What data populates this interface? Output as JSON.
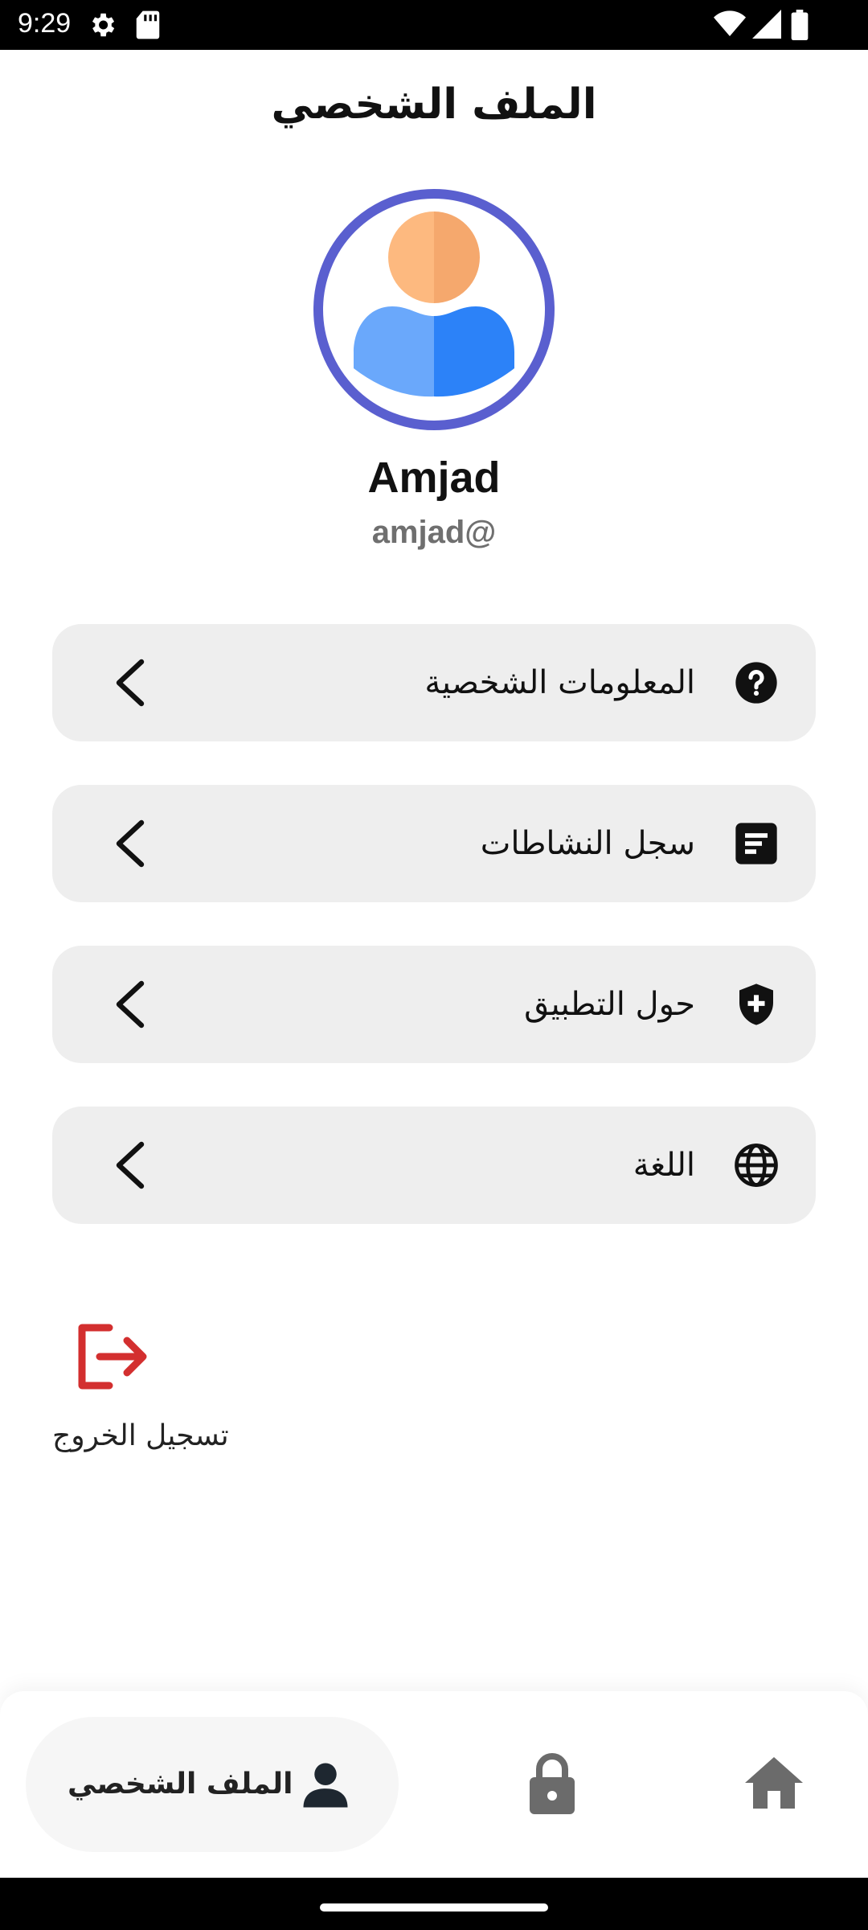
{
  "status_bar": {
    "time": "9:29"
  },
  "header": {
    "title": "الملف الشخصي"
  },
  "profile": {
    "name": "Amjad",
    "handle": "amjad@"
  },
  "menu": [
    {
      "label": "المعلومات الشخصية",
      "icon": "help-circle-icon"
    },
    {
      "label": "سجل النشاطات",
      "icon": "activity-log-icon"
    },
    {
      "label": "حول التطبيق",
      "icon": "shield-plus-icon"
    },
    {
      "label": "اللغة",
      "icon": "globe-icon"
    }
  ],
  "logout": {
    "label": "تسجيل الخروج",
    "color": "#d32f2f"
  },
  "bottom_nav": {
    "active_label": "الملف الشخصي",
    "items": [
      "profile-icon",
      "lock-icon",
      "home-icon"
    ]
  },
  "colors": {
    "avatar_ring": "#5a5fcf",
    "card_bg": "#eeeeee",
    "logout": "#d32f2f"
  }
}
